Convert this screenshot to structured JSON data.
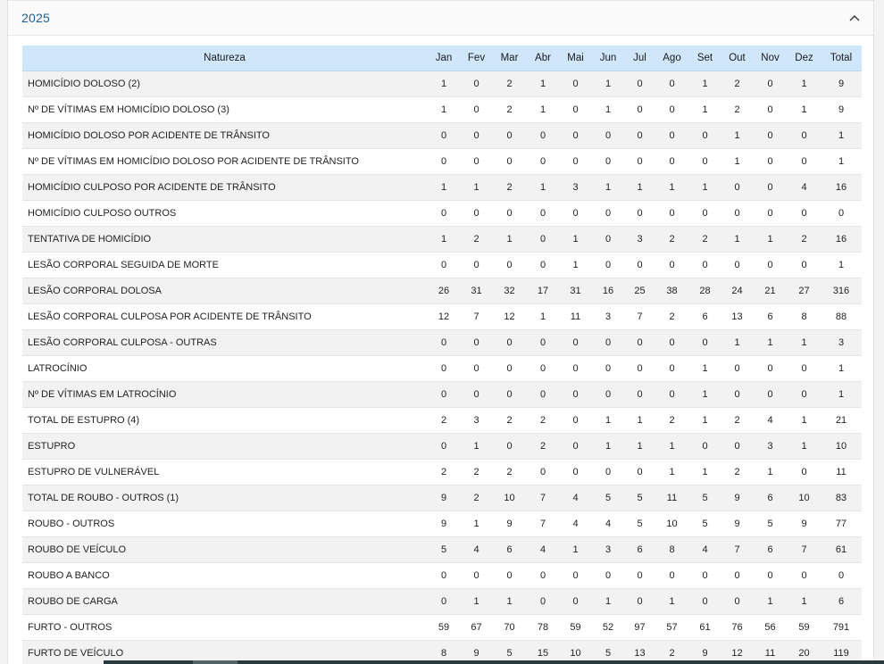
{
  "panel": {
    "title": "2025",
    "collapse_icon": "chevron-up-icon"
  },
  "table": {
    "headers": [
      "Natureza",
      "Jan",
      "Fev",
      "Mar",
      "Abr",
      "Mai",
      "Jun",
      "Jul",
      "Ago",
      "Set",
      "Out",
      "Nov",
      "Dez",
      "Total"
    ],
    "rows": [
      [
        "HOMICÍDIO DOLOSO (2)",
        "1",
        "0",
        "2",
        "1",
        "0",
        "1",
        "0",
        "0",
        "1",
        "2",
        "0",
        "1",
        "9"
      ],
      [
        "Nº DE VÍTIMAS EM HOMICÍDIO DOLOSO (3)",
        "1",
        "0",
        "2",
        "1",
        "0",
        "1",
        "0",
        "0",
        "1",
        "2",
        "0",
        "1",
        "9"
      ],
      [
        "HOMICÍDIO DOLOSO POR ACIDENTE DE TRÂNSITO",
        "0",
        "0",
        "0",
        "0",
        "0",
        "0",
        "0",
        "0",
        "0",
        "1",
        "0",
        "0",
        "1"
      ],
      [
        "Nº DE VÍTIMAS EM HOMICÍDIO DOLOSO POR ACIDENTE DE TRÂNSITO",
        "0",
        "0",
        "0",
        "0",
        "0",
        "0",
        "0",
        "0",
        "0",
        "1",
        "0",
        "0",
        "1"
      ],
      [
        "HOMICÍDIO CULPOSO POR ACIDENTE DE TRÂNSITO",
        "1",
        "1",
        "2",
        "1",
        "3",
        "1",
        "1",
        "1",
        "1",
        "0",
        "0",
        "4",
        "16"
      ],
      [
        "HOMICÍDIO CULPOSO OUTROS",
        "0",
        "0",
        "0",
        "0",
        "0",
        "0",
        "0",
        "0",
        "0",
        "0",
        "0",
        "0",
        "0"
      ],
      [
        "TENTATIVA DE HOMICÍDIO",
        "1",
        "2",
        "1",
        "0",
        "1",
        "0",
        "3",
        "2",
        "2",
        "1",
        "1",
        "2",
        "16"
      ],
      [
        "LESÃO CORPORAL SEGUIDA DE MORTE",
        "0",
        "0",
        "0",
        "0",
        "1",
        "0",
        "0",
        "0",
        "0",
        "0",
        "0",
        "0",
        "1"
      ],
      [
        "LESÃO CORPORAL DOLOSA",
        "26",
        "31",
        "32",
        "17",
        "31",
        "16",
        "25",
        "38",
        "28",
        "24",
        "21",
        "27",
        "316"
      ],
      [
        "LESÃO CORPORAL CULPOSA POR ACIDENTE DE TRÂNSITO",
        "12",
        "7",
        "12",
        "1",
        "11",
        "3",
        "7",
        "2",
        "6",
        "13",
        "6",
        "8",
        "88"
      ],
      [
        "LESÃO CORPORAL CULPOSA - OUTRAS",
        "0",
        "0",
        "0",
        "0",
        "0",
        "0",
        "0",
        "0",
        "0",
        "1",
        "1",
        "1",
        "3"
      ],
      [
        "LATROCÍNIO",
        "0",
        "0",
        "0",
        "0",
        "0",
        "0",
        "0",
        "0",
        "1",
        "0",
        "0",
        "0",
        "1"
      ],
      [
        "Nº DE VÍTIMAS EM LATROCÍNIO",
        "0",
        "0",
        "0",
        "0",
        "0",
        "0",
        "0",
        "0",
        "1",
        "0",
        "0",
        "0",
        "1"
      ],
      [
        "TOTAL DE ESTUPRO (4)",
        "2",
        "3",
        "2",
        "2",
        "0",
        "1",
        "1",
        "2",
        "1",
        "2",
        "4",
        "1",
        "21"
      ],
      [
        "ESTUPRO",
        "0",
        "1",
        "0",
        "2",
        "0",
        "1",
        "1",
        "1",
        "0",
        "0",
        "3",
        "1",
        "10"
      ],
      [
        "ESTUPRO DE VULNERÁVEL",
        "2",
        "2",
        "2",
        "0",
        "0",
        "0",
        "0",
        "1",
        "1",
        "2",
        "1",
        "0",
        "11"
      ],
      [
        "TOTAL DE ROUBO - OUTROS (1)",
        "9",
        "2",
        "10",
        "7",
        "4",
        "5",
        "5",
        "11",
        "5",
        "9",
        "6",
        "10",
        "83"
      ],
      [
        "ROUBO - OUTROS",
        "9",
        "1",
        "9",
        "7",
        "4",
        "4",
        "5",
        "10",
        "5",
        "9",
        "5",
        "9",
        "77"
      ],
      [
        "ROUBO DE VEÍCULO",
        "5",
        "4",
        "6",
        "4",
        "1",
        "3",
        "6",
        "8",
        "4",
        "7",
        "6",
        "7",
        "61"
      ],
      [
        "ROUBO A BANCO",
        "0",
        "0",
        "0",
        "0",
        "0",
        "0",
        "0",
        "0",
        "0",
        "0",
        "0",
        "0",
        "0"
      ],
      [
        "ROUBO DE CARGA",
        "0",
        "1",
        "1",
        "0",
        "0",
        "1",
        "0",
        "1",
        "0",
        "0",
        "1",
        "1",
        "6"
      ],
      [
        "FURTO - OUTROS",
        "59",
        "67",
        "70",
        "78",
        "59",
        "52",
        "97",
        "57",
        "61",
        "76",
        "56",
        "59",
        "791"
      ],
      [
        "FURTO DE VEÍCULO",
        "8",
        "9",
        "5",
        "15",
        "10",
        "5",
        "13",
        "2",
        "9",
        "12",
        "11",
        "20",
        "119"
      ]
    ]
  }
}
